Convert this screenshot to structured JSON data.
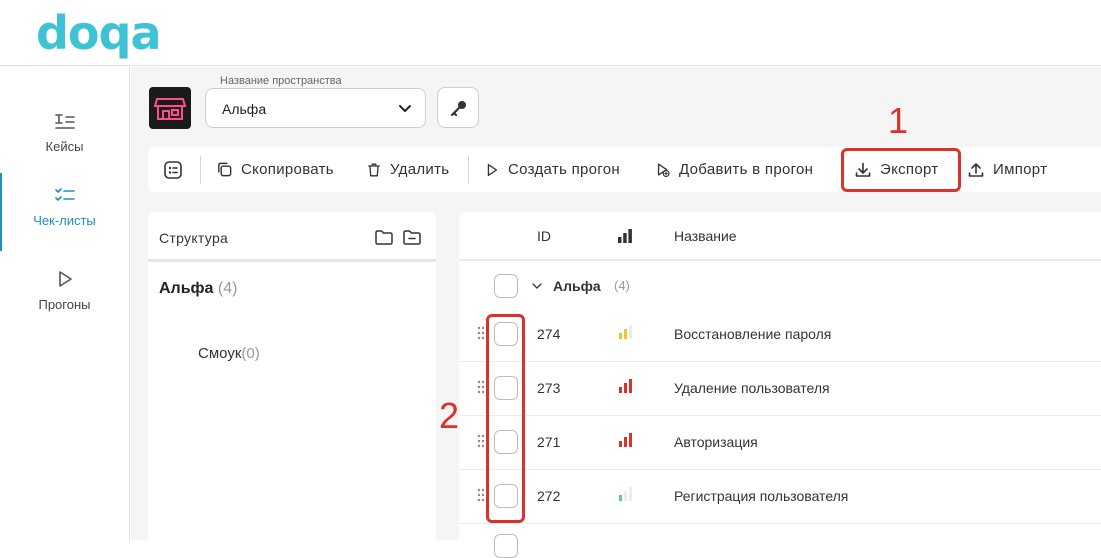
{
  "app": {
    "logo": "doqa"
  },
  "sidebar": {
    "items": [
      {
        "label": "Кейсы",
        "icon": "test-cases-icon",
        "active": false
      },
      {
        "label": "Чек-листы",
        "icon": "checklist-icon",
        "active": true
      },
      {
        "label": "Прогоны",
        "icon": "play-icon",
        "active": false
      }
    ]
  },
  "space": {
    "label": "Название пространства",
    "value": "Альфа"
  },
  "toolbar": {
    "copy": "Скопировать",
    "delete": "Удалить",
    "create_run": "Создать прогон",
    "add_to_run": "Добавить в прогон",
    "export": "Экспорт",
    "import": "Импорт"
  },
  "annotations": {
    "one": "1",
    "two": "2"
  },
  "structure": {
    "title": "Структура",
    "root": {
      "name": "Альфа",
      "count": "(4)"
    },
    "children": [
      {
        "name": "Смоук",
        "count": "(0)"
      }
    ]
  },
  "table": {
    "headers": {
      "id": "ID",
      "name": "Название"
    },
    "group": {
      "name": "Альфа",
      "count": "(4)"
    },
    "rows": [
      {
        "id": "274",
        "name": "Восстановление пароля",
        "priority": "medium"
      },
      {
        "id": "273",
        "name": "Удаление пользователя",
        "priority": "high"
      },
      {
        "id": "271",
        "name": "Авторизация",
        "priority": "high"
      },
      {
        "id": "272",
        "name": "Регистрация пользователя",
        "priority": "low"
      }
    ]
  },
  "colors": {
    "brand": "#3ec3d5",
    "accent": "#1f8fbf",
    "annotation": "#d9322b",
    "priority_high": "#d9322b",
    "priority_medium": "#f2c12e",
    "priority_low": "#5cc9a7"
  }
}
